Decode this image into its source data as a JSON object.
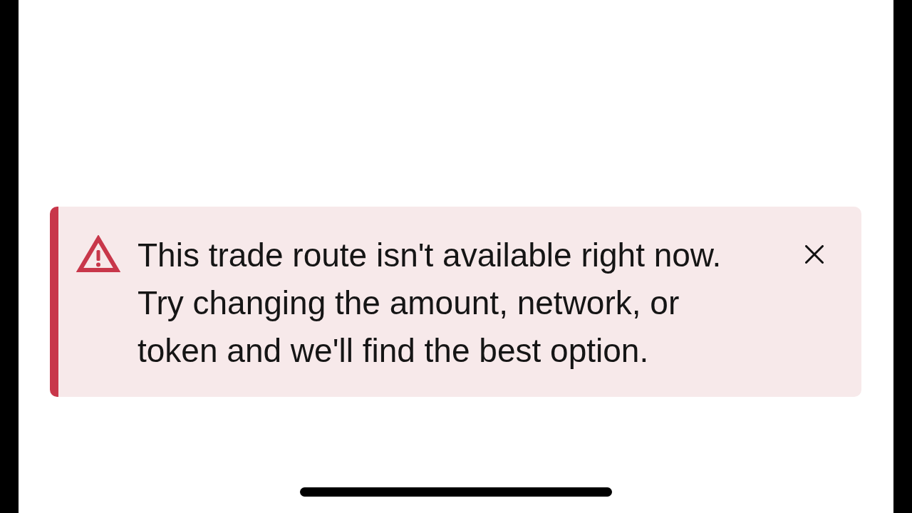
{
  "alert": {
    "message": "This trade route isn't available right now. Try changing the amount, network, or token and we'll find the best option.",
    "dismissible": true
  }
}
